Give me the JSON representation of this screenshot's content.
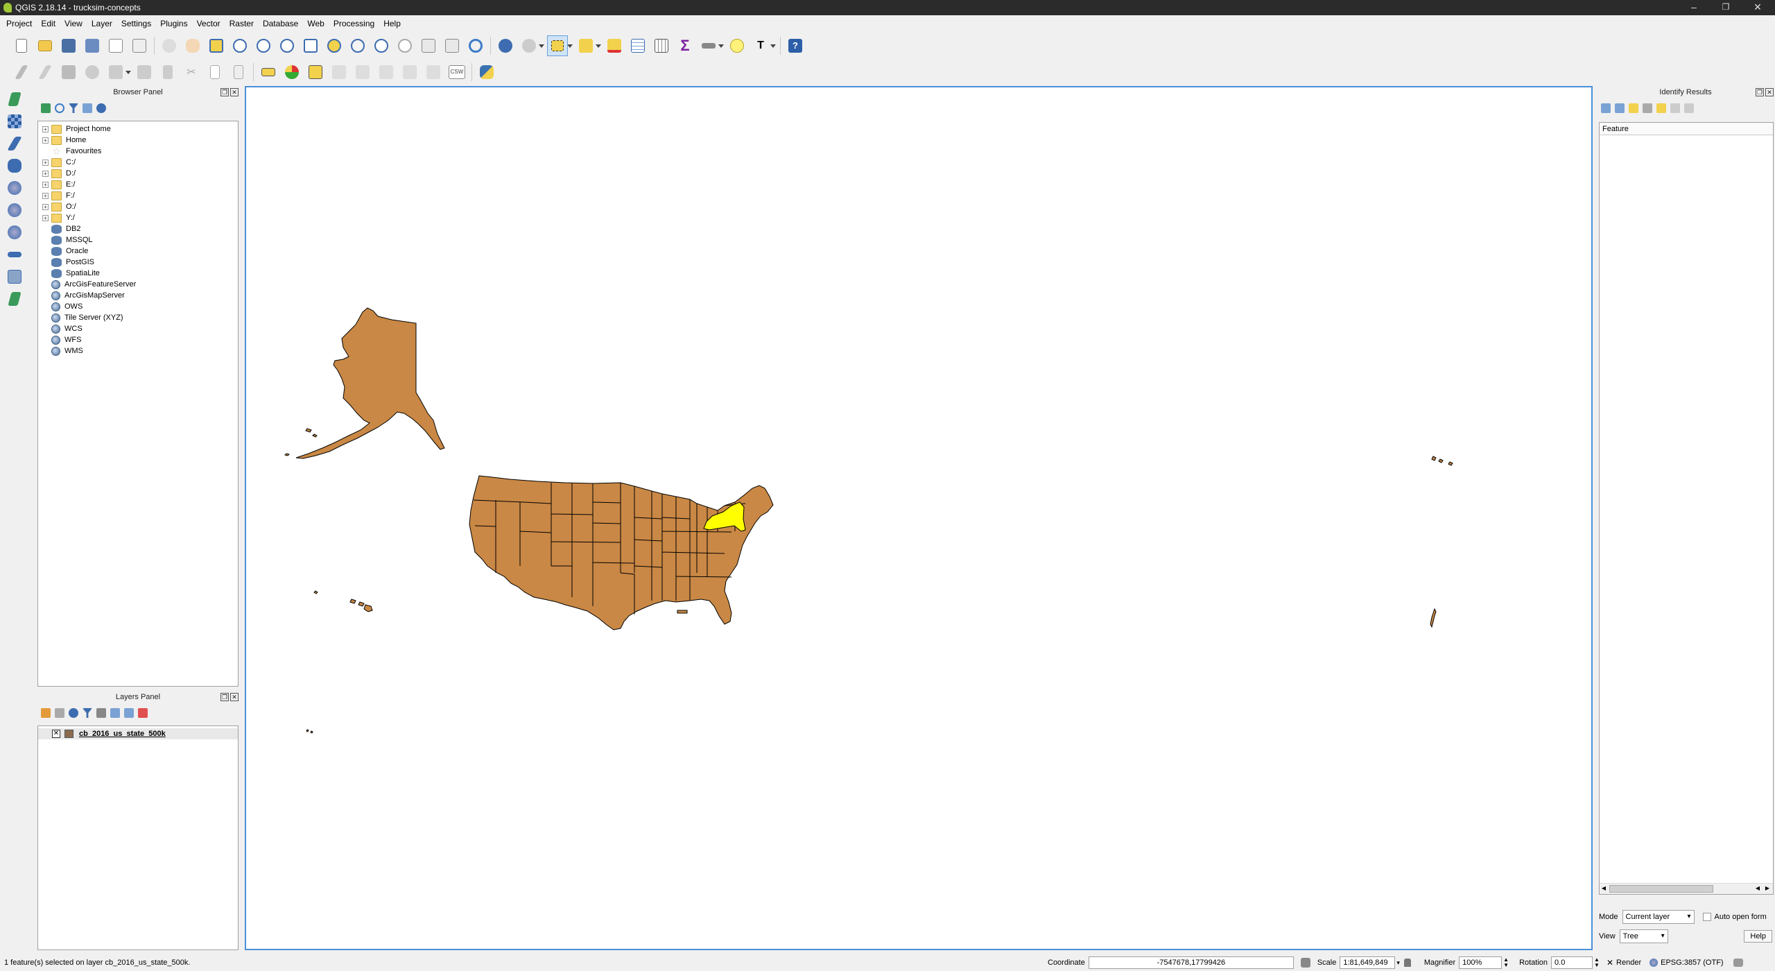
{
  "window": {
    "title": "QGIS 2.18.14 - trucksim-concepts",
    "minimize": "–",
    "restore": "❐",
    "close": "✕"
  },
  "menu": [
    "Project",
    "Edit",
    "View",
    "Layer",
    "Settings",
    "Plugins",
    "Vector",
    "Raster",
    "Database",
    "Web",
    "Processing",
    "Help"
  ],
  "toolbar": {
    "csw_label": "CSW",
    "help_icon": "?"
  },
  "browser": {
    "title": "Browser Panel",
    "items": [
      {
        "label": "Project home",
        "icon": "folder",
        "expand": true
      },
      {
        "label": "Home",
        "icon": "folder",
        "expand": true
      },
      {
        "label": "Favourites",
        "icon": "star",
        "expand": false
      },
      {
        "label": "C:/",
        "icon": "folder",
        "expand": true
      },
      {
        "label": "D:/",
        "icon": "folder",
        "expand": true
      },
      {
        "label": "E:/",
        "icon": "folder",
        "expand": true
      },
      {
        "label": "F:/",
        "icon": "folder",
        "expand": true
      },
      {
        "label": "O:/",
        "icon": "folder",
        "expand": true
      },
      {
        "label": "Y:/",
        "icon": "folder",
        "expand": true
      },
      {
        "label": "DB2",
        "icon": "db",
        "expand": false
      },
      {
        "label": "MSSQL",
        "icon": "db",
        "expand": false
      },
      {
        "label": "Oracle",
        "icon": "db",
        "expand": false
      },
      {
        "label": "PostGIS",
        "icon": "db",
        "expand": false
      },
      {
        "label": "SpatiaLite",
        "icon": "db",
        "expand": false
      },
      {
        "label": "ArcGisFeatureServer",
        "icon": "globe",
        "expand": false
      },
      {
        "label": "ArcGisMapServer",
        "icon": "globe",
        "expand": false
      },
      {
        "label": "OWS",
        "icon": "globe",
        "expand": false
      },
      {
        "label": "Tile Server (XYZ)",
        "icon": "globe",
        "expand": false
      },
      {
        "label": "WCS",
        "icon": "globe",
        "expand": false
      },
      {
        "label": "WFS",
        "icon": "globe",
        "expand": false
      },
      {
        "label": "WMS",
        "icon": "globe",
        "expand": false
      }
    ]
  },
  "layers": {
    "title": "Layers Panel",
    "items": [
      {
        "name": "cb_2016_us_state_500k",
        "checked": "✕",
        "swatch": "#8b6b50"
      }
    ]
  },
  "identify": {
    "title": "Identify Results",
    "column": "Feature",
    "mode_label": "Mode",
    "mode_value": "Current layer",
    "auto_open": "Auto open form",
    "view_label": "View",
    "view_value": "Tree",
    "help": "Help"
  },
  "map": {
    "fill": "#c98845",
    "selected_fill": "#ffff00",
    "stroke": "#000000"
  },
  "status": {
    "message": "1 feature(s) selected on layer cb_2016_us_state_500k.",
    "coordinate_label": "Coordinate",
    "coordinate_value": "-7547678,17799426",
    "scale_label": "Scale",
    "scale_value": "1:81,649,849",
    "magnifier_label": "Magnifier",
    "magnifier_value": "100%",
    "rotation_label": "Rotation",
    "rotation_value": "0.0",
    "render_label": "Render",
    "render_check": "✕",
    "crs": "EPSG:3857 (OTF)"
  }
}
